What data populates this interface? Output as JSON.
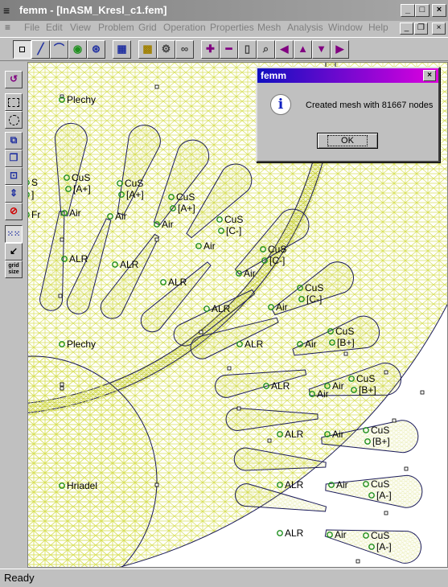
{
  "window": {
    "title": "femm - [InASM_Kresl_c1.fem]",
    "min": "_",
    "max": "□",
    "close": "×",
    "app_glyph": "≡"
  },
  "menu": [
    "File",
    "Edit",
    "View",
    "Problem",
    "Grid",
    "Operation",
    "Properties",
    "Mesh",
    "Analysis",
    "Window",
    "Help"
  ],
  "mdi": {
    "min": "_",
    "restore": "❐",
    "close": "×"
  },
  "status": {
    "text": "Ready"
  },
  "dialog": {
    "title": "femm",
    "message": "Created mesh with 81667 nodes",
    "ok_label": "OK",
    "icon": "i",
    "close": "×"
  },
  "sidebar_grid_label": "grid size",
  "canvas": {
    "blocks": [
      {
        "label": "Plechy"
      },
      {
        "label": "Plechy"
      },
      {
        "label": "Hriadel"
      },
      {
        "label": "CuS"
      },
      {
        "label": "[A+]"
      },
      {
        "label": "CuS"
      },
      {
        "label": "[A+]"
      },
      {
        "label": "CuS"
      },
      {
        "label": "[A+]"
      },
      {
        "label": "CuS"
      },
      {
        "label": "[C-]"
      },
      {
        "label": "CuS"
      },
      {
        "label": "[C-]"
      },
      {
        "label": "CuS"
      },
      {
        "label": "[C-]"
      },
      {
        "label": "CuS"
      },
      {
        "label": "[B+]"
      },
      {
        "label": "CuS"
      },
      {
        "label": "[B+]"
      },
      {
        "label": "CuS"
      },
      {
        "label": "[B+]"
      },
      {
        "label": "CuS"
      },
      {
        "label": "[A-]"
      },
      {
        "label": "CuS"
      },
      {
        "label": "[A-]"
      },
      {
        "label": "ALR"
      },
      {
        "label": "ALR"
      },
      {
        "label": "ALR"
      },
      {
        "label": "ALR"
      },
      {
        "label": "ALR"
      },
      {
        "label": "ALR"
      },
      {
        "label": "ALR"
      },
      {
        "label": "ALR"
      },
      {
        "label": "ALR"
      },
      {
        "label": "Air"
      },
      {
        "label": "Air"
      },
      {
        "label": "Air"
      },
      {
        "label": "Air"
      },
      {
        "label": "Air"
      },
      {
        "label": "Air"
      },
      {
        "label": "Air"
      },
      {
        "label": "Air"
      },
      {
        "label": "Air"
      },
      {
        "label": "Air"
      },
      {
        "label": "Air"
      },
      {
        "label": "Air"
      },
      {
        "label": "Fr"
      },
      {
        "label": "S"
      },
      {
        "label": "]"
      }
    ]
  },
  "colors": {
    "mesh": "#d8e05a",
    "geometry": "#1a1a5a",
    "nodes": "#1f8f1f",
    "dialog_title": "#1010c0"
  }
}
